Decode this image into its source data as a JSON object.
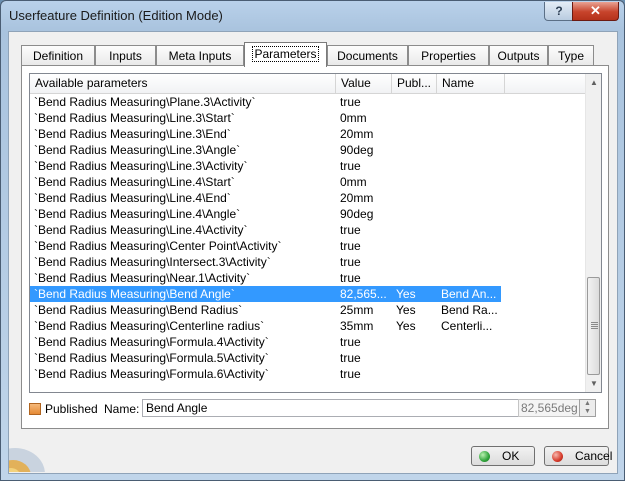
{
  "window": {
    "title": "Userfeature Definition (Edition Mode)",
    "help_glyph": "?",
    "close_glyph": "✕"
  },
  "tabs": [
    {
      "label": "Definition",
      "active": false
    },
    {
      "label": "Inputs",
      "active": false
    },
    {
      "label": "Meta Inputs",
      "active": false
    },
    {
      "label": "Parameters",
      "active": true
    },
    {
      "label": "Documents",
      "active": false
    },
    {
      "label": "Properties",
      "active": false
    },
    {
      "label": "Outputs",
      "active": false
    },
    {
      "label": "Type",
      "active": false
    }
  ],
  "table": {
    "columns": [
      "Available parameters",
      "Value",
      "Publ...",
      "Name"
    ],
    "rows": [
      {
        "param": "`Bend Radius Measuring\\Plane.3\\Activity`",
        "value": "true",
        "published": "",
        "name": ""
      },
      {
        "param": "`Bend Radius Measuring\\Line.3\\Start`",
        "value": "0mm",
        "published": "",
        "name": ""
      },
      {
        "param": "`Bend Radius Measuring\\Line.3\\End`",
        "value": "20mm",
        "published": "",
        "name": ""
      },
      {
        "param": "`Bend Radius Measuring\\Line.3\\Angle`",
        "value": "90deg",
        "published": "",
        "name": ""
      },
      {
        "param": "`Bend Radius Measuring\\Line.3\\Activity`",
        "value": "true",
        "published": "",
        "name": ""
      },
      {
        "param": "`Bend Radius Measuring\\Line.4\\Start`",
        "value": "0mm",
        "published": "",
        "name": ""
      },
      {
        "param": "`Bend Radius Measuring\\Line.4\\End`",
        "value": "20mm",
        "published": "",
        "name": ""
      },
      {
        "param": "`Bend Radius Measuring\\Line.4\\Angle`",
        "value": "90deg",
        "published": "",
        "name": ""
      },
      {
        "param": "`Bend Radius Measuring\\Line.4\\Activity`",
        "value": "true",
        "published": "",
        "name": ""
      },
      {
        "param": "`Bend Radius Measuring\\Center Point\\Activity`",
        "value": "true",
        "published": "",
        "name": ""
      },
      {
        "param": "`Bend Radius Measuring\\Intersect.3\\Activity`",
        "value": "true",
        "published": "",
        "name": ""
      },
      {
        "param": "`Bend Radius Measuring\\Near.1\\Activity`",
        "value": "true",
        "published": "",
        "name": ""
      },
      {
        "param": "`Bend Radius Measuring\\Bend Angle`",
        "value": "82,565...",
        "published": "Yes",
        "name": "Bend An...",
        "selected": true
      },
      {
        "param": "`Bend Radius Measuring\\Bend Radius`",
        "value": "25mm",
        "published": "Yes",
        "name": "Bend Ra..."
      },
      {
        "param": "`Bend Radius Measuring\\Centerline radius`",
        "value": "35mm",
        "published": "Yes",
        "name": "Centerli..."
      },
      {
        "param": "`Bend Radius Measuring\\Formula.4\\Activity`",
        "value": "true",
        "published": "",
        "name": ""
      },
      {
        "param": "`Bend Radius Measuring\\Formula.5\\Activity`",
        "value": "true",
        "published": "",
        "name": ""
      },
      {
        "param": "`Bend Radius Measuring\\Formula.6\\Activity`",
        "value": "true",
        "published": "",
        "name": ""
      }
    ]
  },
  "published_checkbox": {
    "label": "Published",
    "checked": true
  },
  "name_field": {
    "label": "Name:",
    "value": "Bend Angle"
  },
  "value_field": {
    "value": "82,565deg"
  },
  "buttons": {
    "ok": "OK",
    "cancel": "Cancel"
  },
  "colors": {
    "selection": "#3399ff",
    "ok_dot": "#2fa33a",
    "cancel_dot": "#d63a2a"
  }
}
